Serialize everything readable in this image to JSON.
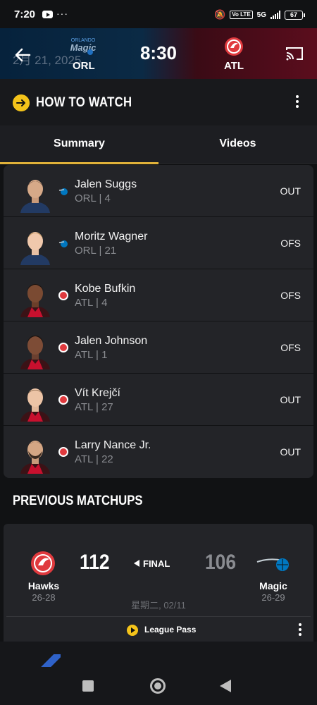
{
  "status_bar": {
    "time": "7:20",
    "overflow": "···",
    "volte_label": "Vo LTE",
    "network_label": "5G",
    "battery": "67",
    "icons": [
      "youtube-icon",
      "mute-icon",
      "signal-icon",
      "battery-icon"
    ]
  },
  "game_header": {
    "date": "2月 21, 2025",
    "away_team": "ORL",
    "home_team": "ATL",
    "game_time": "8:30",
    "icons": [
      "back-arrow-icon",
      "magic-logo",
      "hawks-logo",
      "cast-icon"
    ]
  },
  "how_to_watch": {
    "title": "HOW TO WATCH",
    "icons": [
      "arrow-right-circle-icon",
      "more-vert-icon"
    ]
  },
  "tabs": [
    {
      "label": "Summary",
      "selected": true
    },
    {
      "label": "Videos",
      "selected": false
    }
  ],
  "injuries": [
    {
      "name": "Jalen Suggs",
      "meta": "ORL | 4",
      "status": "OUT",
      "team": "orl"
    },
    {
      "name": "Moritz Wagner",
      "meta": "ORL | 21",
      "status": "OFS",
      "team": "orl"
    },
    {
      "name": "Kobe Bufkin",
      "meta": "ATL | 4",
      "status": "OFS",
      "team": "atl"
    },
    {
      "name": "Jalen Johnson",
      "meta": "ATL | 1",
      "status": "OFS",
      "team": "atl"
    },
    {
      "name": "Vít Krejčí",
      "meta": "ATL | 27",
      "status": "OUT",
      "team": "atl"
    },
    {
      "name": "Larry Nance Jr.",
      "meta": "ATL | 22",
      "status": "OUT",
      "team": "atl"
    }
  ],
  "previous_matchups": {
    "title": "PREVIOUS MATCHUPS",
    "game": {
      "home_name": "Hawks",
      "home_record": "26-28",
      "home_score": "112",
      "status": "FINAL",
      "away_score": "106",
      "away_name": "Magic",
      "away_record": "26-29",
      "date": "星期二, 02/11"
    },
    "league_pass": "League Pass"
  },
  "colors": {
    "accent_gold": "#e1b23a",
    "hawks_red": "#e03a3e",
    "magic_blue": "#0077c0",
    "background": "#111214",
    "card": "#232428"
  }
}
